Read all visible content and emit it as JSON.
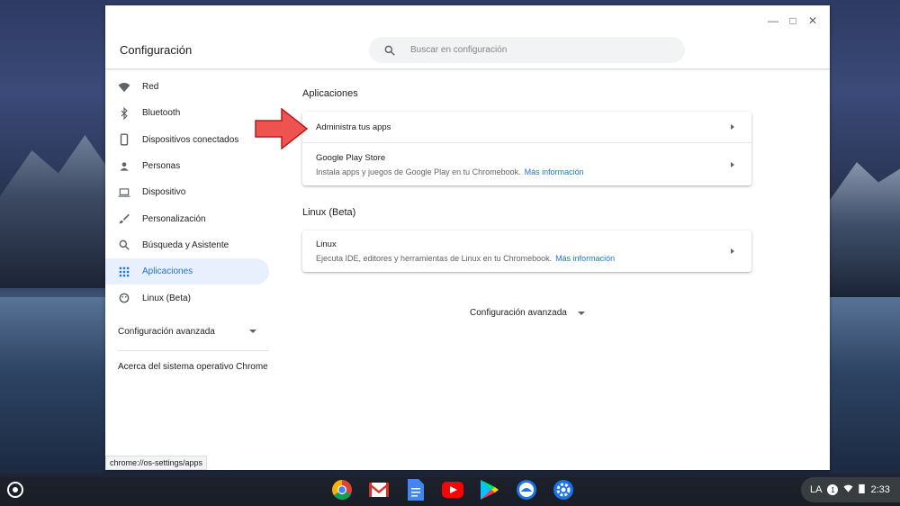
{
  "window": {
    "title": "Configuración",
    "controls": {
      "minimize": "—",
      "maximize": "□",
      "close": "✕"
    }
  },
  "search": {
    "placeholder": "Buscar en configuración"
  },
  "sidebar": {
    "items": [
      {
        "label": "Red",
        "icon": "wifi-icon"
      },
      {
        "label": "Bluetooth",
        "icon": "bluetooth-icon"
      },
      {
        "label": "Dispositivos conectados",
        "icon": "phone-icon"
      },
      {
        "label": "Personas",
        "icon": "person-icon"
      },
      {
        "label": "Dispositivo",
        "icon": "laptop-icon"
      },
      {
        "label": "Personalización",
        "icon": "brush-icon"
      },
      {
        "label": "Búsqueda y Asistente",
        "icon": "search-icon"
      },
      {
        "label": "Aplicaciones",
        "icon": "apps-grid-icon",
        "active": true
      },
      {
        "label": "Linux (Beta)",
        "icon": "linux-icon"
      }
    ],
    "advanced": "Configuración avanzada",
    "about": "Acerca del sistema operativo Chrome"
  },
  "main": {
    "apps_section": {
      "title": "Aplicaciones",
      "manage": {
        "title": "Administra tus apps"
      },
      "play": {
        "title": "Google Play Store",
        "desc": "Instala apps y juegos de Google Play en tu Chromebook.",
        "link": "Más información"
      }
    },
    "linux_section": {
      "title": "Linux (Beta)",
      "linux": {
        "title": "Linux",
        "desc": "Ejecuta IDE, editores y herramientas de Linux en tu Chromebook.",
        "link": "Más información"
      }
    },
    "advanced": "Configuración avanzada"
  },
  "status_url": "chrome://os-settings/apps",
  "shelf": {
    "apps": [
      "chrome-icon",
      "gmail-icon",
      "docs-icon",
      "youtube-icon",
      "play-store-icon",
      "files-icon",
      "settings-icon"
    ],
    "tray": {
      "keyboard": "LA",
      "notifications": "1",
      "time": "2:33"
    }
  },
  "colors": {
    "accent": "#1a73e8",
    "active_bg": "#e8f0fe",
    "pointer_arrow": "#e53935"
  }
}
